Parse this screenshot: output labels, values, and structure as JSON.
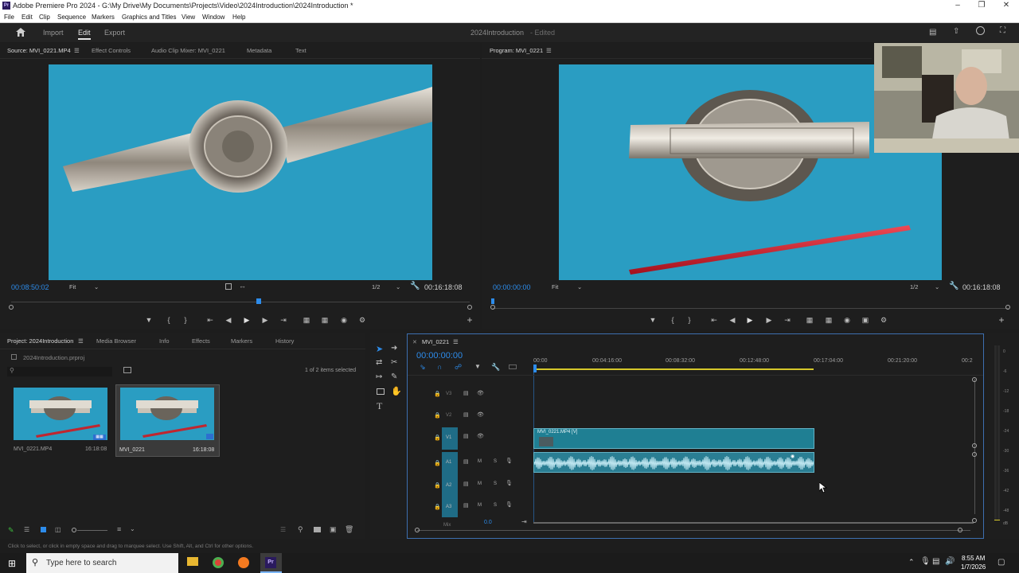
{
  "window": {
    "title": "Adobe Premiere Pro 2024 - G:\\My Drive\\My Documents\\Projects\\Video\\2024Introduction\\2024Introduction *"
  },
  "menu": [
    "File",
    "Edit",
    "Clip",
    "Sequence",
    "Markers",
    "Graphics and Titles",
    "View",
    "Window",
    "Help"
  ],
  "header": {
    "workspaces": [
      "Import",
      "Edit",
      "Export"
    ],
    "active_workspace": "Edit",
    "project_name": "2024Introduction",
    "edited_label": "- Edited"
  },
  "source": {
    "tabs": [
      "Source: MVI_0221.MP4",
      "Effect Controls",
      "Audio Clip Mixer: MVI_0221",
      "Metadata",
      "Text"
    ],
    "timecode": "00:08:50:02",
    "fit": "Fit",
    "resolution": "1/2",
    "duration": "00:16:18:08",
    "playhead_fraction": 0.54
  },
  "program": {
    "tab": "Program: MVI_0221",
    "timecode": "00:00:00:00",
    "fit": "Fit",
    "resolution": "1/2",
    "duration": "00:16:18:08",
    "playhead_fraction": 0.0
  },
  "project": {
    "tabs": [
      "Project: 2024Introduction",
      "Media Browser",
      "Info",
      "Effects",
      "Markers",
      "History"
    ],
    "file": "2024Introduction.prproj",
    "selection": "1 of 2 items selected",
    "items": [
      {
        "name": "MVI_0221.MP4",
        "duration": "16:18:08"
      },
      {
        "name": "MVI_0221",
        "duration": "16:18:08"
      }
    ]
  },
  "timeline": {
    "tab": "MVI_0221",
    "timecode": "00:00:00:00",
    "ruler": [
      "00:00",
      "00:04:16:00",
      "00:08:32:00",
      "00:12:48:00",
      "00:17:04:00",
      "00:21:20:00",
      "00:2"
    ],
    "tracks": [
      "V3",
      "V2",
      "V1",
      "A1",
      "A2",
      "A3"
    ],
    "video_clip": "MVI_0221.MP4 [V]",
    "mix_value": "0.0",
    "mix_label": "Mix"
  },
  "meters": [
    "0",
    "-6",
    "-12",
    "-18",
    "-24",
    "-30",
    "-36",
    "-42",
    "-48",
    "dB"
  ],
  "status": "Click to select, or click in empty space and drag to marquee select. Use Shift, Alt, and Ctrl for other options.",
  "taskbar": {
    "search_placeholder": "Type here to search",
    "time": "8:55 AM",
    "date": "1/7/2026"
  },
  "colors": {
    "accent_blue": "#2d8ceb",
    "clip_teal": "#1f7f93",
    "audio_clip": "#2a7e93",
    "video_bg": "#2a9dc2"
  }
}
